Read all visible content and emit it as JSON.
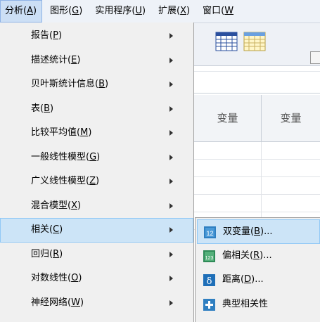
{
  "menubar": {
    "items": [
      {
        "text": "分析",
        "key": "A"
      },
      {
        "text": "图形",
        "key": "G"
      },
      {
        "text": "实用程序",
        "key": "U"
      },
      {
        "text": "扩展",
        "key": "X"
      },
      {
        "text": "窗口",
        "key": "W"
      }
    ]
  },
  "analyze_menu": {
    "items": [
      {
        "text": "报告",
        "key": "P"
      },
      {
        "text": "描述统计",
        "key": "E"
      },
      {
        "text": "贝叶斯统计信息",
        "key": "B"
      },
      {
        "text": "表",
        "key": "B"
      },
      {
        "text": "比较平均值",
        "key": "M"
      },
      {
        "text": "一般线性模型",
        "key": "G"
      },
      {
        "text": "广义线性模型",
        "key": "Z"
      },
      {
        "text": "混合模型",
        "key": "X"
      },
      {
        "text": "相关",
        "key": "C"
      },
      {
        "text": "回归",
        "key": "R"
      },
      {
        "text": "对数线性",
        "key": "O"
      },
      {
        "text": "神经网络",
        "key": "W"
      }
    ]
  },
  "correlate_submenu": {
    "items": [
      {
        "text": "双变量",
        "key": "B",
        "suffix": "...",
        "icon": "bivariate-icon"
      },
      {
        "text": "偏相关",
        "key": "R",
        "suffix": "...",
        "icon": "partial-correlation-icon"
      },
      {
        "text": "距离",
        "key": "D",
        "suffix": "...",
        "icon": "distances-icon"
      },
      {
        "text": "典型相关性",
        "key": "",
        "suffix": "",
        "icon": "canonical-correlation-icon"
      }
    ]
  },
  "data_grid": {
    "column_headers": [
      "变量",
      "变量"
    ]
  },
  "colors": {
    "highlight": "#cce4f7",
    "highlight_border": "#90c8f6",
    "menu_bg": "#f0f0f0"
  }
}
